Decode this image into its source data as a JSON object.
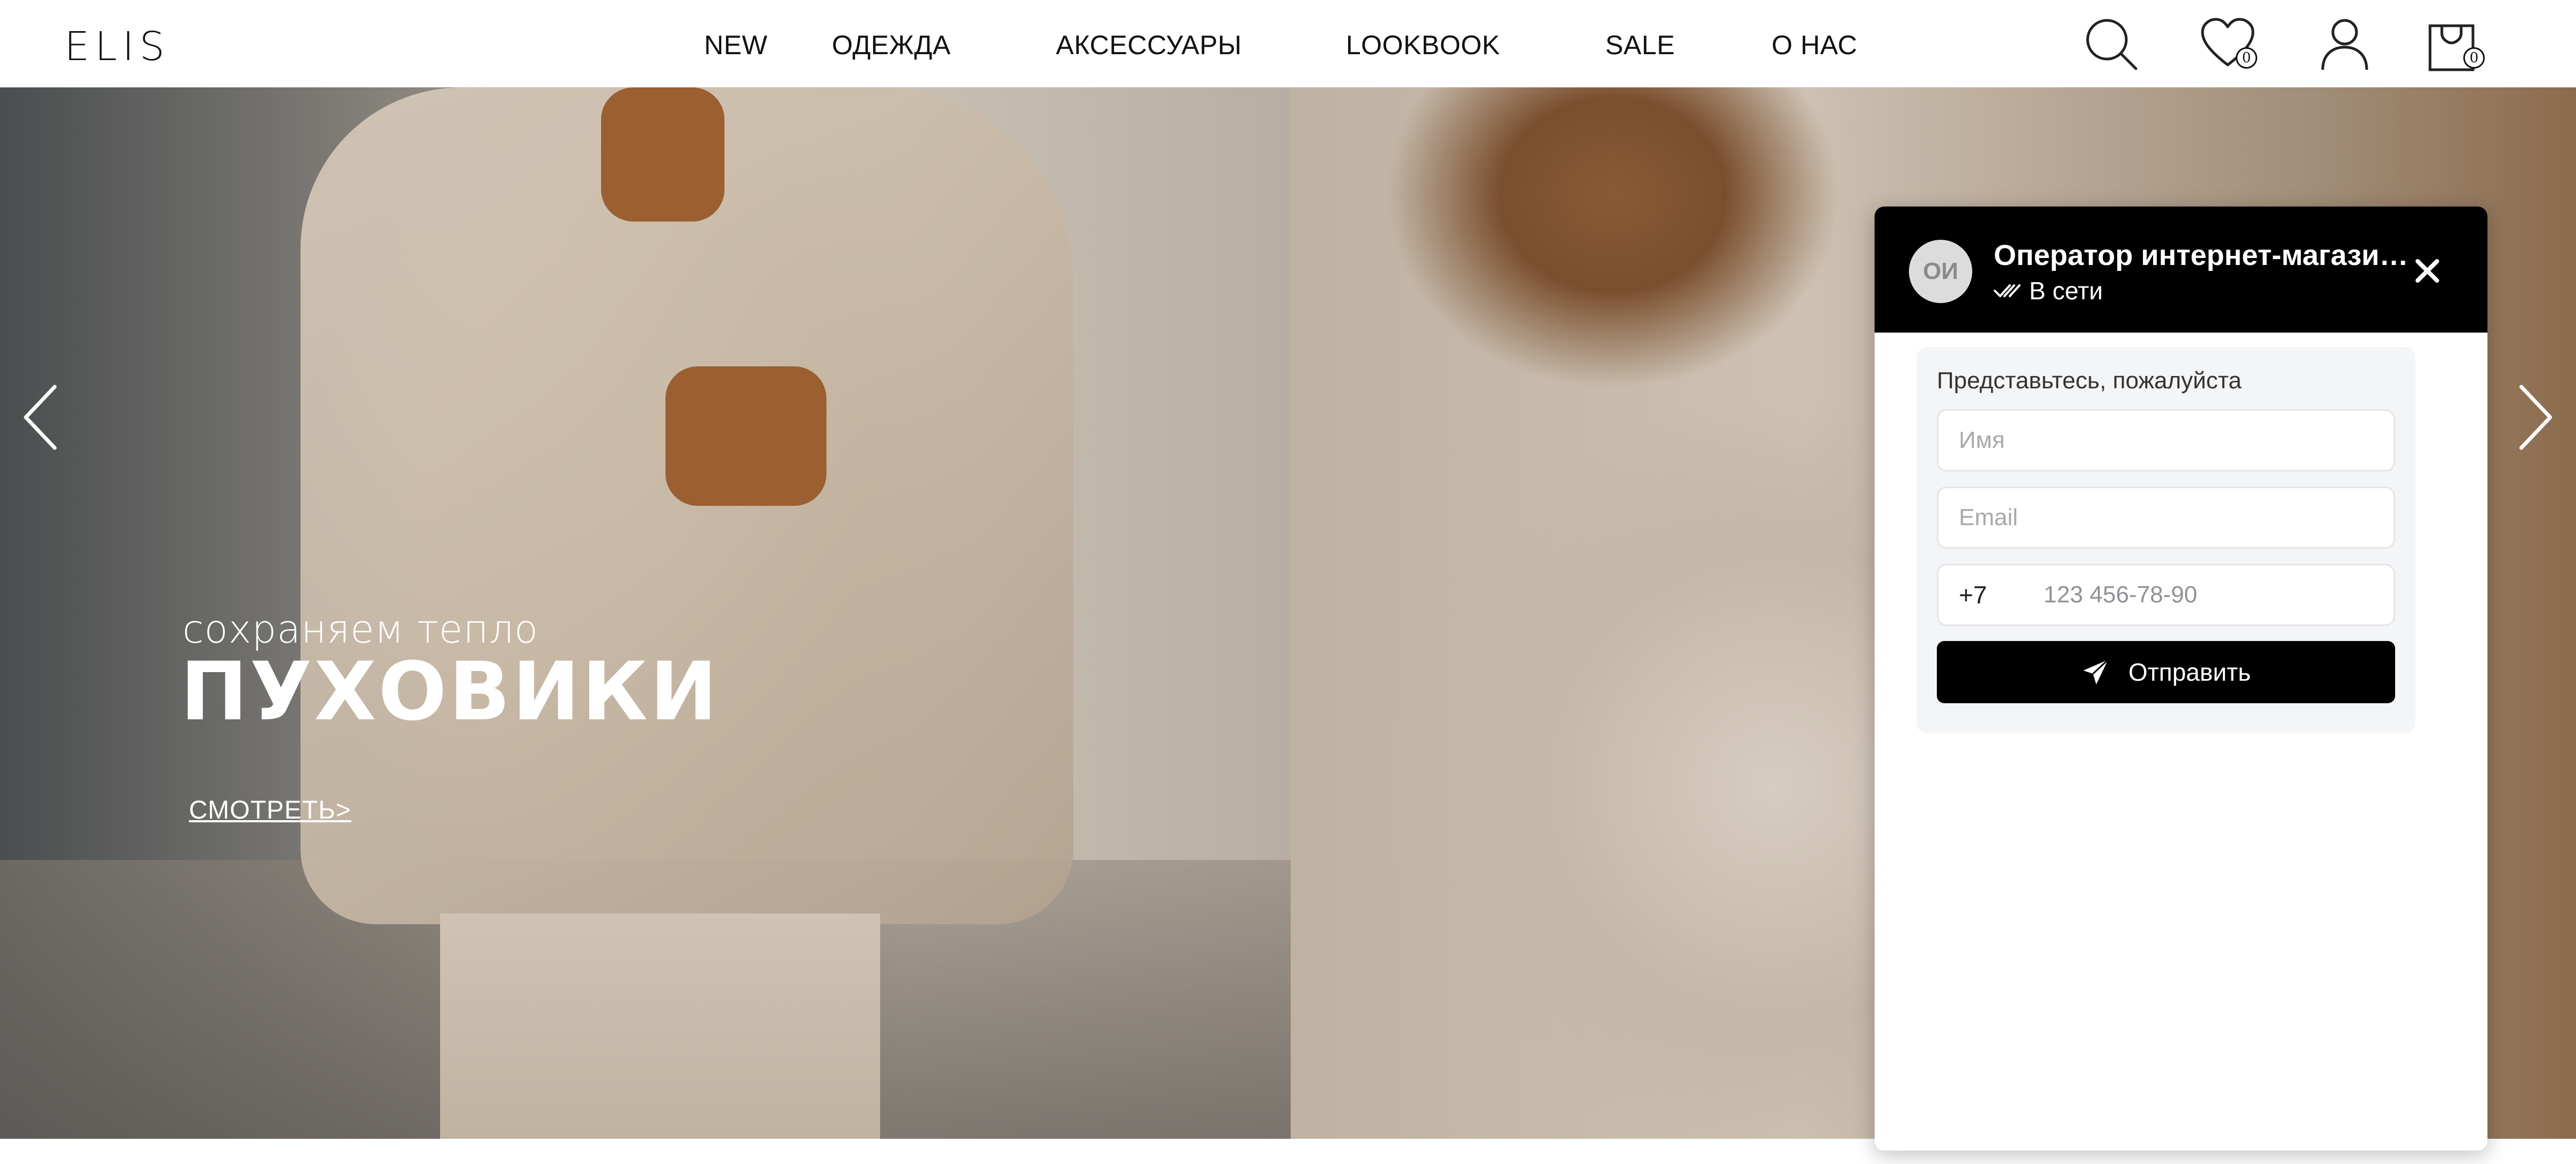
{
  "header": {
    "logo": "ELIS",
    "nav": [
      {
        "label": "NEW"
      },
      {
        "label": "ОДЕЖДА"
      },
      {
        "label": "АКСЕССУАРЫ"
      },
      {
        "label": "LOOKBOOK"
      },
      {
        "label": "SALE"
      },
      {
        "label": "О НАС"
      }
    ],
    "icons": {
      "search": "search-icon",
      "wishlist": "heart-icon",
      "account": "user-icon",
      "cart": "bag-icon"
    },
    "wishlist_count": "0",
    "cart_count": "0"
  },
  "hero": {
    "subtitle": "сохраняем тепло",
    "title": "ПУХОВИКИ",
    "link": "СМОТРЕТЬ>",
    "prev_icon": "chevron-left-icon",
    "next_icon": "chevron-right-icon"
  },
  "chat": {
    "avatar": "ОИ",
    "title": "Оператор интернет-магазина",
    "status": "В сети",
    "form_label": "Представьтесь, пожалуйста",
    "name_placeholder": "Имя",
    "email_placeholder": "Email",
    "phone_code": "+7",
    "phone_placeholder": "123 456-78-90",
    "send_label": "Отправить",
    "accent": "#000000"
  }
}
